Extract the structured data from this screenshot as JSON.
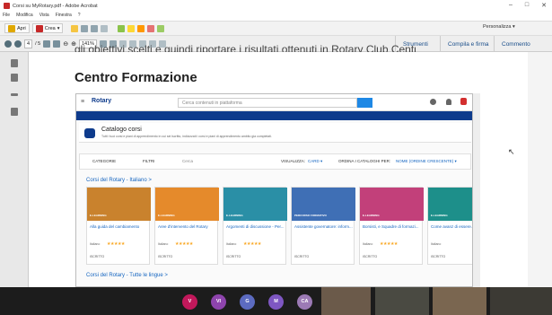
{
  "window": {
    "title": "Corsi su MyRotary.pdf - Adobe Acrobat",
    "controls": [
      "–",
      "□",
      "✕"
    ]
  },
  "menu": [
    "File",
    "Modifica",
    "Vista",
    "Finestra",
    "?"
  ],
  "toolbar": {
    "open": "Apri",
    "create": "Crea",
    "personalize": "Personalizza"
  },
  "nav": {
    "page": "4",
    "total": "/ 5",
    "zoom": "141%",
    "tools": "Strumenti",
    "sign": "Compila e firma",
    "comment": "Commento"
  },
  "pdf": {
    "line_cut": "gli obiettivi scelti e quindi riportare i risultati ottenuti in Rotary Club Central.",
    "section_title": "Centro Formazione"
  },
  "portal": {
    "logo": "Rotary",
    "search_placeholder": "Cerca contenuti in piattaforma",
    "catalog_title": "Catalogo corsi",
    "catalog_desc": "Tutti i tuoi corsi e piani di apprendimento in cui sei iscritto, indicizzati i corsi e piani di apprendimento ambito gia completati.",
    "filter": {
      "categories": "CATEGORIE",
      "filters": "FILTRI",
      "search": "Cerca",
      "view_label": "VISUALIZZA:",
      "view_value": "CARD ▾",
      "order_label": "ORDINA I CATALOGHI PER:",
      "order_value": "NOME (ORDINE CRESCENTE) ▾"
    },
    "section1": "Corsi del Rotary - Italiano  >",
    "section2": "Corsi del Rotary - Tutte le lingue  >",
    "cards": [
      {
        "tag": "E-LEARNING",
        "title": "Alla guida del cambiamento",
        "lang": "Italiano",
        "stars": "★★★★★",
        "status": "ISCRITTO",
        "color": "#c9822d"
      },
      {
        "tag": "E-LEARNING",
        "title": "Aree d'intervento del Rotary",
        "lang": "Italiano",
        "stars": "★★★★★",
        "status": "ISCRITTO",
        "color": "#e58a2b"
      },
      {
        "tag": "E-LEARNING",
        "title": "Argomenti di discussione - Per...",
        "lang": "Italiano",
        "stars": "★★★★★",
        "status": "ISCRITTO",
        "color": "#2a8fa6"
      },
      {
        "tag": "PERCORSO FORMATIVO",
        "title": "Assistente governatore: inform...",
        "lang": "",
        "stars": "",
        "status": "ISCRITTO",
        "color": "#3f6fb5"
      },
      {
        "tag": "E-LEARNING",
        "title": "Borsisti, e Squadre di formazi...",
        "lang": "Italiano",
        "stars": "★★★★★",
        "status": "ISCRITTO",
        "color": "#c2407a"
      },
      {
        "tag": "E-LEARNING",
        "title": "Come avanz di essere...",
        "lang": "Italiano",
        "stars": "",
        "status": "ISCRITTO",
        "color": "#1d8f8a"
      }
    ]
  },
  "participants": [
    {
      "initial": "V",
      "color": "#c2185b"
    },
    {
      "initial": "VI",
      "color": "#8e44ad"
    },
    {
      "initial": "G",
      "color": "#5c6bc0"
    },
    {
      "initial": "M",
      "color": "#7e57c2"
    },
    {
      "initial": "CA",
      "color": "#9c7ab5"
    }
  ]
}
